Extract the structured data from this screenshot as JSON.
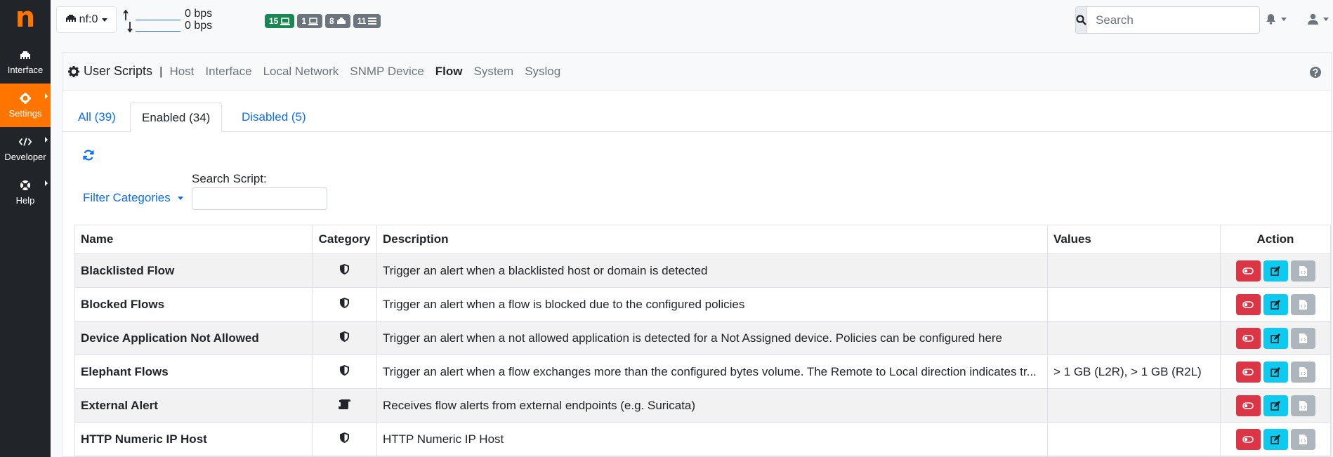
{
  "logo": "n",
  "sidebar": {
    "items": [
      {
        "label": "Interface",
        "icon": "ethernet-icon",
        "active": false
      },
      {
        "label": "Settings",
        "icon": "gear-icon",
        "active": true
      },
      {
        "label": "Developer",
        "icon": "code-icon",
        "active": false
      },
      {
        "label": "Help",
        "icon": "lifebuoy-icon",
        "active": false
      }
    ]
  },
  "topbar": {
    "interface_label": "nf:0",
    "upload_bps": "0 bps",
    "download_bps": "0 bps",
    "badges": [
      {
        "value": "15",
        "icon": "laptop-icon",
        "color": "#198754"
      },
      {
        "value": "1",
        "icon": "laptop-icon",
        "color": "#6c757d"
      },
      {
        "value": "8",
        "icon": "ethernet-icon",
        "color": "#6c757d"
      },
      {
        "value": "11",
        "icon": "list-icon",
        "color": "#6c757d"
      }
    ],
    "search_placeholder": "Search"
  },
  "header": {
    "title": "User Scripts",
    "separator": "|",
    "links": [
      "Host",
      "Interface",
      "Local Network",
      "SNMP Device",
      "Flow",
      "System",
      "Syslog"
    ],
    "active_link": "Flow"
  },
  "tabs": [
    {
      "label": "All (39)",
      "active": false
    },
    {
      "label": "Enabled (34)",
      "active": true
    },
    {
      "label": "Disabled (5)",
      "active": false
    }
  ],
  "filters": {
    "category_label": "Filter Categories",
    "search_label": "Search Script:",
    "search_value": ""
  },
  "table": {
    "columns": [
      "Name",
      "Category",
      "Description",
      "Values",
      "Action"
    ],
    "rows": [
      {
        "name": "Blacklisted Flow",
        "category_icon": "shield-icon",
        "description": "Trigger an alert when a blacklisted host or domain is detected",
        "values": ""
      },
      {
        "name": "Blocked Flows",
        "category_icon": "shield-icon",
        "description": "Trigger an alert when a flow is blocked due to the configured policies",
        "values": ""
      },
      {
        "name": "Device Application Not Allowed",
        "category_icon": "shield-icon",
        "description": "Trigger an alert when a not allowed application is detected for a Not Assigned device. Policies can be configured here",
        "values": ""
      },
      {
        "name": "Elephant Flows",
        "category_icon": "shield-icon",
        "description": "Trigger an alert when a flow exchanges more than the configured bytes volume. The Remote to Local direction indicates tr...",
        "values": "> 1 GB (L2R), > 1 GB (R2L)"
      },
      {
        "name": "External Alert",
        "category_icon": "scroll-icon",
        "description": "Receives flow alerts from external endpoints (e.g. Suricata)",
        "values": ""
      },
      {
        "name": "HTTP Numeric IP Host",
        "category_icon": "shield-icon",
        "description": "HTTP Numeric IP Host",
        "values": ""
      }
    ]
  }
}
